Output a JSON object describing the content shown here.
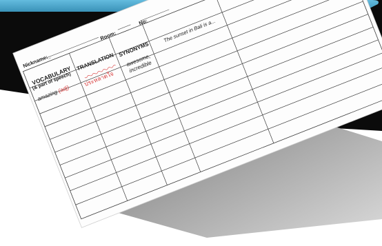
{
  "worksheet": {
    "header": {
      "nickname_label": "Nickname:_",
      "room_label": "Room: ____",
      "no_label": "No:"
    },
    "columns": {
      "vocabulary": "VOCABULARY",
      "part_of_speech": "(& part of speech)",
      "translation": "TRANSLATION",
      "synonyms": "SYNONYMS"
    },
    "row1": {
      "word": "amazing",
      "part": "(adj)",
      "translation": "ประหลาดใจ",
      "synonyms_line1": "awesome,",
      "synonyms_line2": "incredible",
      "example": "The sunset in Bali is a..."
    }
  },
  "colors": {
    "frame_teal": "#46a3c9",
    "frame_dark": "#0b0b0b",
    "grey_shadow": "#8f8f8f",
    "paper": "#fdfdfd",
    "ink_red": "#d83a3a"
  }
}
